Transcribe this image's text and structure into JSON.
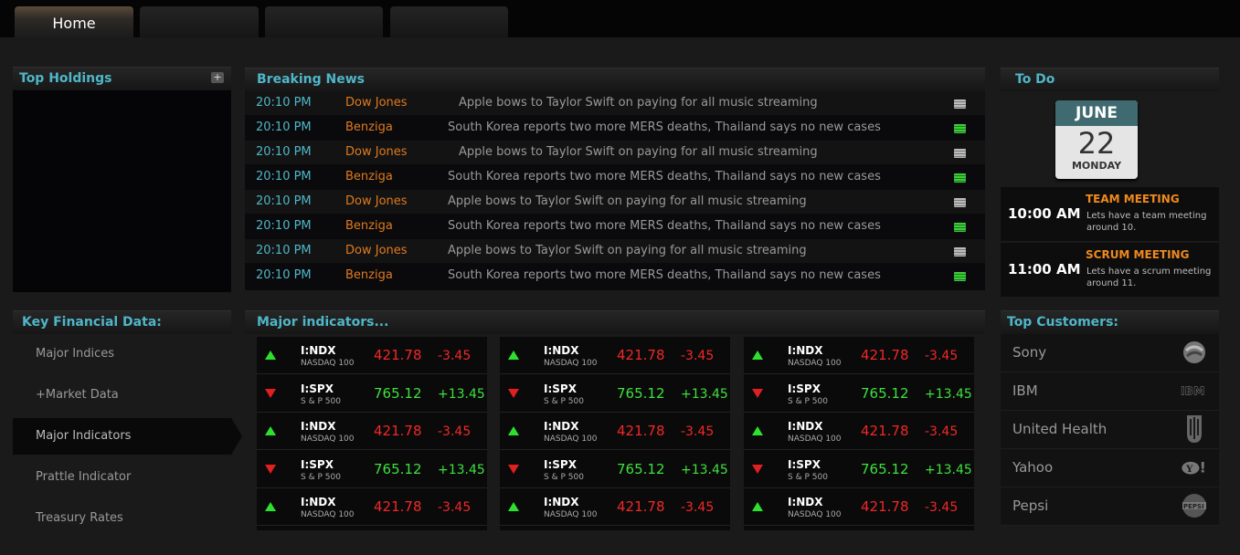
{
  "tabs": [
    {
      "label": "Home",
      "active": true
    },
    {
      "label": "",
      "active": false
    },
    {
      "label": "",
      "active": false
    },
    {
      "label": "",
      "active": false
    }
  ],
  "top_holdings": {
    "title": "Top Holdings",
    "add": "+"
  },
  "breaking_news": {
    "title": "Breaking News",
    "items": [
      {
        "time": "20:10 PM",
        "source": "Dow Jones",
        "headline": "Apple bows to Taylor Swift on paying for all music streaming",
        "icon": "grey"
      },
      {
        "time": "20:10 PM",
        "source": "Benziga",
        "headline": "South Korea reports two more MERS deaths, Thailand says no new cases",
        "icon": "green"
      },
      {
        "time": "20:10 PM",
        "source": "Dow Jones",
        "headline": "Apple bows to Taylor Swift on paying for all music streaming",
        "icon": "grey"
      },
      {
        "time": "20:10 PM",
        "source": "Benziga",
        "headline": "South Korea reports two more MERS deaths, Thailand says no new cases",
        "icon": "green"
      },
      {
        "time": "20:10 PM",
        "source": "Dow Jones",
        "headline": "Apple bows to Taylor Swift on paying for all music streaming",
        "icon": "grey"
      },
      {
        "time": "20:10 PM",
        "source": "Benziga",
        "headline": "South Korea reports two more MERS deaths, Thailand says no new cases",
        "icon": "green"
      },
      {
        "time": "20:10 PM",
        "source": "Dow Jones",
        "headline": "Apple bows to Taylor Swift on paying for all music streaming",
        "icon": "grey"
      },
      {
        "time": "20:10 PM",
        "source": "Benziga",
        "headline": "South Korea reports two more MERS deaths, Thailand says no new cases",
        "icon": "green"
      }
    ]
  },
  "todo": {
    "title": "To Do",
    "calendar": {
      "month": "JUNE",
      "day": "22",
      "weekday": "MONDAY"
    },
    "items": [
      {
        "time": "10:00 AM",
        "title": "TEAM MEETING",
        "desc": "Lets have a team meeting around 10."
      },
      {
        "time": "11:00 AM",
        "title": "SCRUM MEETING",
        "desc": "Lets have a scrum meeting around 11."
      }
    ]
  },
  "key_financial": {
    "title": "Key Financial Data:",
    "items": [
      {
        "label": "Major Indices",
        "active": false
      },
      {
        "label": "+Market Data",
        "active": false
      },
      {
        "label": "Major Indicators",
        "active": true
      },
      {
        "label": "Prattle Indicator",
        "active": false
      },
      {
        "label": "Treasury Rates",
        "active": false
      }
    ]
  },
  "major_indicators": {
    "title": "Major indicators...",
    "columns": [
      [
        {
          "dir": "up",
          "symbol": "I:NDX",
          "name": "NASDAQ 100",
          "value": "421.78",
          "change": "-3.45"
        },
        {
          "dir": "down",
          "symbol": "I:SPX",
          "name": "S & P 500",
          "value": "765.12",
          "change": "+13.45"
        },
        {
          "dir": "up",
          "symbol": "I:NDX",
          "name": "NASDAQ 100",
          "value": "421.78",
          "change": "-3.45"
        },
        {
          "dir": "down",
          "symbol": "I:SPX",
          "name": "S & P 500",
          "value": "765.12",
          "change": "+13.45"
        },
        {
          "dir": "up",
          "symbol": "I:NDX",
          "name": "NASDAQ 100",
          "value": "421.78",
          "change": "-3.45"
        }
      ],
      [
        {
          "dir": "up",
          "symbol": "I:NDX",
          "name": "NASDAQ 100",
          "value": "421.78",
          "change": "-3.45"
        },
        {
          "dir": "down",
          "symbol": "I:SPX",
          "name": "S & P 500",
          "value": "765.12",
          "change": "+13.45"
        },
        {
          "dir": "up",
          "symbol": "I:NDX",
          "name": "NASDAQ 100",
          "value": "421.78",
          "change": "-3.45"
        },
        {
          "dir": "down",
          "symbol": "I:SPX",
          "name": "S & P 500",
          "value": "765.12",
          "change": "+13.45"
        },
        {
          "dir": "up",
          "symbol": "I:NDX",
          "name": "NASDAQ 100",
          "value": "421.78",
          "change": "-3.45"
        }
      ],
      [
        {
          "dir": "up",
          "symbol": "I:NDX",
          "name": "NASDAQ 100",
          "value": "421.78",
          "change": "-3.45"
        },
        {
          "dir": "down",
          "symbol": "I:SPX",
          "name": "S & P 500",
          "value": "765.12",
          "change": "+13.45"
        },
        {
          "dir": "up",
          "symbol": "I:NDX",
          "name": "NASDAQ 100",
          "value": "421.78",
          "change": "-3.45"
        },
        {
          "dir": "down",
          "symbol": "I:SPX",
          "name": "S & P 500",
          "value": "765.12",
          "change": "+13.45"
        },
        {
          "dir": "up",
          "symbol": "I:NDX",
          "name": "NASDAQ 100",
          "value": "421.78",
          "change": "-3.45"
        }
      ]
    ]
  },
  "top_customers": {
    "title": "Top Customers:",
    "items": [
      {
        "name": "Sony",
        "logo": "sony-logo-icon"
      },
      {
        "name": "IBM",
        "logo": "ibm-logo-icon"
      },
      {
        "name": "United Health",
        "logo": "united-health-logo-icon"
      },
      {
        "name": "Yahoo",
        "logo": "yahoo-logo-icon"
      },
      {
        "name": "Pepsi",
        "logo": "pepsi-logo-icon"
      }
    ]
  }
}
